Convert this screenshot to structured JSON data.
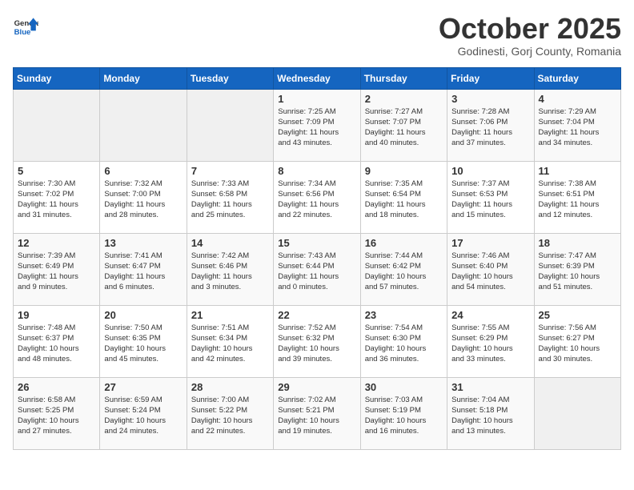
{
  "header": {
    "logo_general": "General",
    "logo_blue": "Blue",
    "title": "October 2025",
    "subtitle": "Godinesti, Gorj County, Romania"
  },
  "weekdays": [
    "Sunday",
    "Monday",
    "Tuesday",
    "Wednesday",
    "Thursday",
    "Friday",
    "Saturday"
  ],
  "weeks": [
    [
      {
        "day": "",
        "info": ""
      },
      {
        "day": "",
        "info": ""
      },
      {
        "day": "",
        "info": ""
      },
      {
        "day": "1",
        "info": "Sunrise: 7:25 AM\nSunset: 7:09 PM\nDaylight: 11 hours\nand 43 minutes."
      },
      {
        "day": "2",
        "info": "Sunrise: 7:27 AM\nSunset: 7:07 PM\nDaylight: 11 hours\nand 40 minutes."
      },
      {
        "day": "3",
        "info": "Sunrise: 7:28 AM\nSunset: 7:06 PM\nDaylight: 11 hours\nand 37 minutes."
      },
      {
        "day": "4",
        "info": "Sunrise: 7:29 AM\nSunset: 7:04 PM\nDaylight: 11 hours\nand 34 minutes."
      }
    ],
    [
      {
        "day": "5",
        "info": "Sunrise: 7:30 AM\nSunset: 7:02 PM\nDaylight: 11 hours\nand 31 minutes."
      },
      {
        "day": "6",
        "info": "Sunrise: 7:32 AM\nSunset: 7:00 PM\nDaylight: 11 hours\nand 28 minutes."
      },
      {
        "day": "7",
        "info": "Sunrise: 7:33 AM\nSunset: 6:58 PM\nDaylight: 11 hours\nand 25 minutes."
      },
      {
        "day": "8",
        "info": "Sunrise: 7:34 AM\nSunset: 6:56 PM\nDaylight: 11 hours\nand 22 minutes."
      },
      {
        "day": "9",
        "info": "Sunrise: 7:35 AM\nSunset: 6:54 PM\nDaylight: 11 hours\nand 18 minutes."
      },
      {
        "day": "10",
        "info": "Sunrise: 7:37 AM\nSunset: 6:53 PM\nDaylight: 11 hours\nand 15 minutes."
      },
      {
        "day": "11",
        "info": "Sunrise: 7:38 AM\nSunset: 6:51 PM\nDaylight: 11 hours\nand 12 minutes."
      }
    ],
    [
      {
        "day": "12",
        "info": "Sunrise: 7:39 AM\nSunset: 6:49 PM\nDaylight: 11 hours\nand 9 minutes."
      },
      {
        "day": "13",
        "info": "Sunrise: 7:41 AM\nSunset: 6:47 PM\nDaylight: 11 hours\nand 6 minutes."
      },
      {
        "day": "14",
        "info": "Sunrise: 7:42 AM\nSunset: 6:46 PM\nDaylight: 11 hours\nand 3 minutes."
      },
      {
        "day": "15",
        "info": "Sunrise: 7:43 AM\nSunset: 6:44 PM\nDaylight: 11 hours\nand 0 minutes."
      },
      {
        "day": "16",
        "info": "Sunrise: 7:44 AM\nSunset: 6:42 PM\nDaylight: 10 hours\nand 57 minutes."
      },
      {
        "day": "17",
        "info": "Sunrise: 7:46 AM\nSunset: 6:40 PM\nDaylight: 10 hours\nand 54 minutes."
      },
      {
        "day": "18",
        "info": "Sunrise: 7:47 AM\nSunset: 6:39 PM\nDaylight: 10 hours\nand 51 minutes."
      }
    ],
    [
      {
        "day": "19",
        "info": "Sunrise: 7:48 AM\nSunset: 6:37 PM\nDaylight: 10 hours\nand 48 minutes."
      },
      {
        "day": "20",
        "info": "Sunrise: 7:50 AM\nSunset: 6:35 PM\nDaylight: 10 hours\nand 45 minutes."
      },
      {
        "day": "21",
        "info": "Sunrise: 7:51 AM\nSunset: 6:34 PM\nDaylight: 10 hours\nand 42 minutes."
      },
      {
        "day": "22",
        "info": "Sunrise: 7:52 AM\nSunset: 6:32 PM\nDaylight: 10 hours\nand 39 minutes."
      },
      {
        "day": "23",
        "info": "Sunrise: 7:54 AM\nSunset: 6:30 PM\nDaylight: 10 hours\nand 36 minutes."
      },
      {
        "day": "24",
        "info": "Sunrise: 7:55 AM\nSunset: 6:29 PM\nDaylight: 10 hours\nand 33 minutes."
      },
      {
        "day": "25",
        "info": "Sunrise: 7:56 AM\nSunset: 6:27 PM\nDaylight: 10 hours\nand 30 minutes."
      }
    ],
    [
      {
        "day": "26",
        "info": "Sunrise: 6:58 AM\nSunset: 5:25 PM\nDaylight: 10 hours\nand 27 minutes."
      },
      {
        "day": "27",
        "info": "Sunrise: 6:59 AM\nSunset: 5:24 PM\nDaylight: 10 hours\nand 24 minutes."
      },
      {
        "day": "28",
        "info": "Sunrise: 7:00 AM\nSunset: 5:22 PM\nDaylight: 10 hours\nand 22 minutes."
      },
      {
        "day": "29",
        "info": "Sunrise: 7:02 AM\nSunset: 5:21 PM\nDaylight: 10 hours\nand 19 minutes."
      },
      {
        "day": "30",
        "info": "Sunrise: 7:03 AM\nSunset: 5:19 PM\nDaylight: 10 hours\nand 16 minutes."
      },
      {
        "day": "31",
        "info": "Sunrise: 7:04 AM\nSunset: 5:18 PM\nDaylight: 10 hours\nand 13 minutes."
      },
      {
        "day": "",
        "info": ""
      }
    ]
  ]
}
